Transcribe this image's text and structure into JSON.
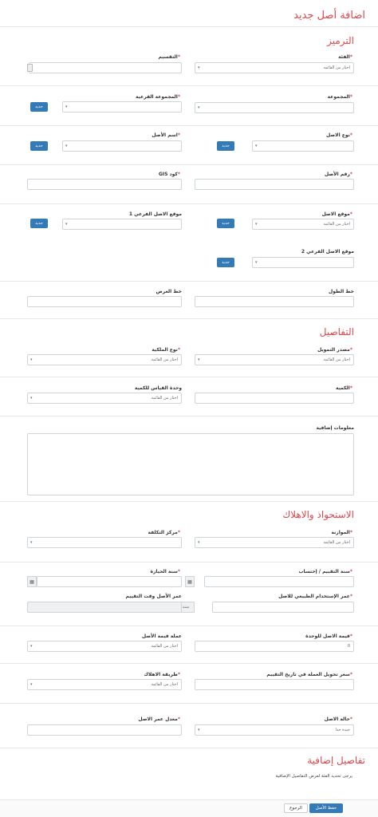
{
  "page": {
    "title": "اضافة أصل جديد"
  },
  "sections": {
    "coding": "الترميز",
    "details": "التفاصيل",
    "acquisition": "الاستحواذ والاهلاك",
    "extra": "تفاصيل إضافية"
  },
  "placeholders": {
    "choose": "اختار من القائمة"
  },
  "fields": {
    "category": "الفئة",
    "classification": "التقسيم",
    "group": "المجموعة",
    "subgroup": "المجموعة الفرعية",
    "asset_type": "نوع الاصل",
    "asset_name": "اسم الأصل",
    "asset_number": "رقم الأصل",
    "gis_code": "كود GIS",
    "asset_location": "موقع الاصل",
    "sub_location_1": "موقع الاصل الفرعي 1",
    "sub_location_2": "موقع الاصل الفرعي 2",
    "longitude": "خط الطول",
    "latitude": "خط العرض",
    "funding_source": "مصدر التمويل",
    "ownership_type": "نوع الملكية",
    "quantity": "الكمية",
    "quantity_unit": "وحدة القياس للكمية",
    "additional_info": "معلومات إضافية",
    "budget": "الموازنة",
    "cost_center": "مركز التكلفة",
    "valuation_year": "سنة التقييم / إحتساب",
    "acquisition_year": "سنة الحيازة",
    "useful_life": "عمر الإستخدام الطبيعي للاصل",
    "age_at_valuation": "عمر الأصل وقت التقييم",
    "unit_value": "قيمة الاصل للوحدة",
    "value_currency": "عملة قيمة الأصل",
    "exchange_rate": "سعر تحويل العملة في تاريخ التقييم",
    "depreciation_method": "طريقة الاهلاك",
    "asset_condition": "حالة الاصل",
    "asset_age_rate": "معدل عمر الاصل"
  },
  "values": {
    "unit_value": "0",
    "year_unit": "سنة",
    "asset_condition": "جيدة جدا"
  },
  "buttons": {
    "new": "جديد",
    "save": "حفظ الأصل",
    "back": "الرجوع"
  },
  "extra_note": "يرجى تحديد الفئة لعرض التفاصيل الإضافية",
  "icons": {
    "calendar": "calendar-icon"
  }
}
